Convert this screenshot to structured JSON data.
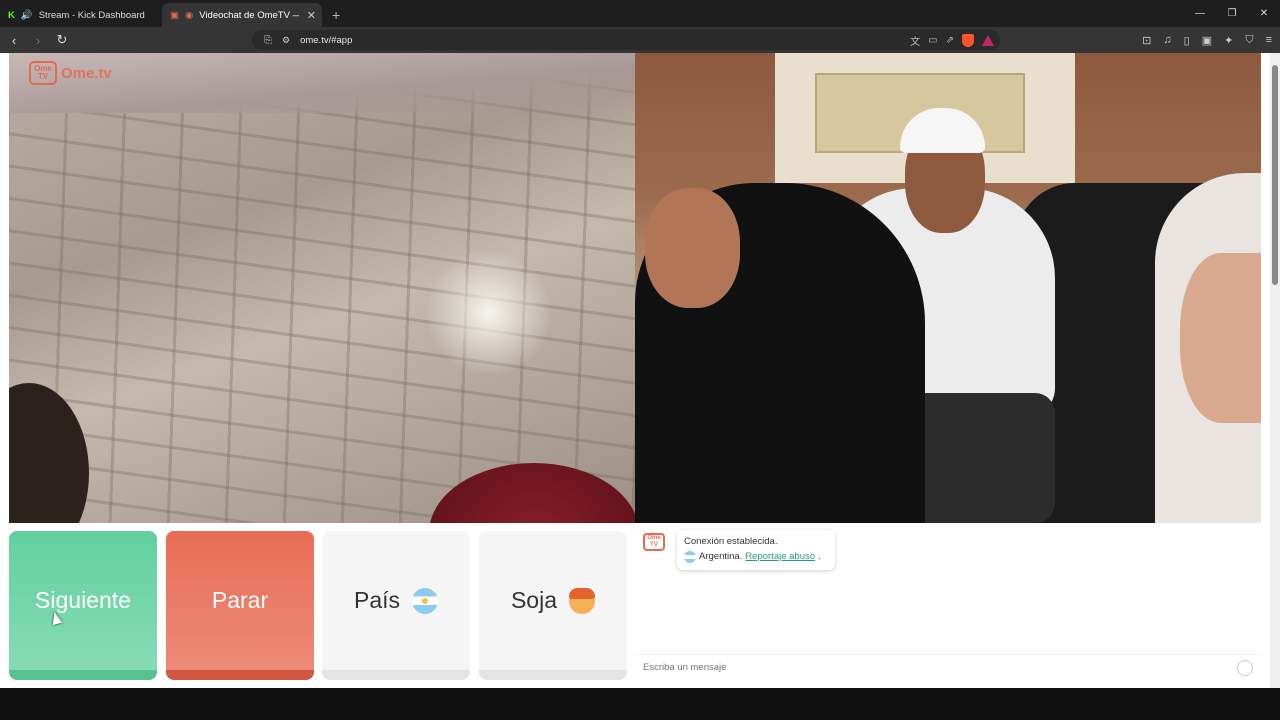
{
  "browser": {
    "tabs": [
      {
        "label": "Stream - Kick Dashboard",
        "active": false
      },
      {
        "label": "Videochat de OmeTV — Alte",
        "active": true
      }
    ],
    "new_tab_label": "+",
    "url": "ome.tv/#app",
    "window_controls": {
      "minimize": "—",
      "restore": "❐",
      "close": "✕"
    }
  },
  "site": {
    "logo_badge": "Ome TV",
    "logo_text": "Ome.tv"
  },
  "controls": {
    "next_label": "Siguiente",
    "stop_label": "Parar",
    "country_label": "País",
    "gender_label": "Soja",
    "country_flag": "argentina-flag-icon",
    "gender_icon": "boy-face-icon"
  },
  "chat": {
    "logo_badge": "Ome TV",
    "status": "Conexión establecida.",
    "country": "Argentina.",
    "report_link": "Reportaje abuso",
    "report_suffix": ".",
    "input_placeholder": "Escriba un mensaje"
  },
  "colors": {
    "next": "#62d09f",
    "stop": "#e96d56",
    "brand": "#e46b50"
  }
}
